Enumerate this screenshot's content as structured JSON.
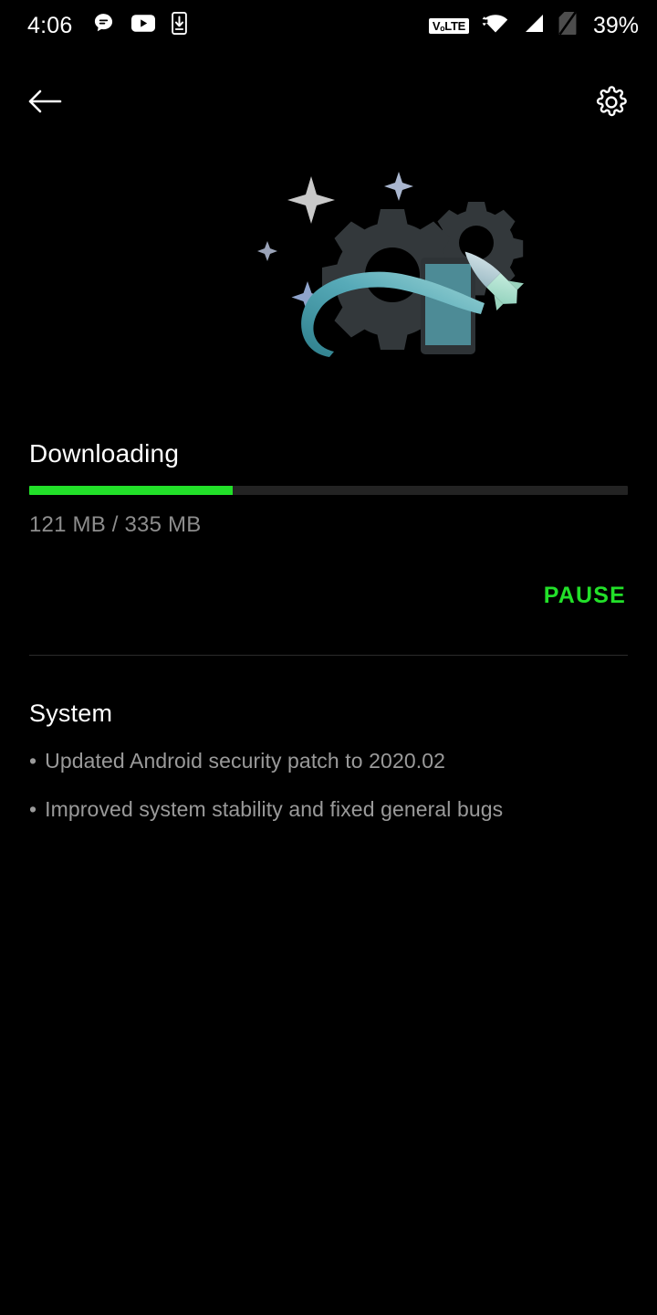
{
  "statusbar": {
    "clock": "4:06",
    "notification_icons": [
      "message-icon",
      "youtube-icon",
      "download-phone-icon"
    ],
    "volte_label": "VₒLTE",
    "signal_icons": [
      "wifi-icon",
      "cellular-signal-icon",
      "sim-off-icon"
    ],
    "battery_percent": "39%"
  },
  "nav": {
    "back_icon": "back-arrow-icon",
    "settings_icon": "gear-icon"
  },
  "hero": {
    "illustration": "system-update-rocket-gears-illustration",
    "colors": {
      "gear": "#33383b",
      "phone_screen": "#4d8b96",
      "phone_frame": "#2e3336",
      "rocket_body": "#a8ddcd",
      "rocket_nose": "#b9cfd4",
      "trail": "#5fb3c0",
      "star": "#b9bfd0"
    }
  },
  "download": {
    "title": "Downloading",
    "progress_percent": 34,
    "size_text": "121 MB / 335 MB",
    "downloaded": "121 MB",
    "total": "335 MB",
    "pause_label": "PAUSE",
    "accent_color": "#22e029",
    "track_color": "#232323"
  },
  "changelog": {
    "section_title": "System",
    "bullet": "•",
    "items": [
      "Updated Android security patch to 2020.02",
      "Improved system stability and fixed general bugs"
    ]
  }
}
